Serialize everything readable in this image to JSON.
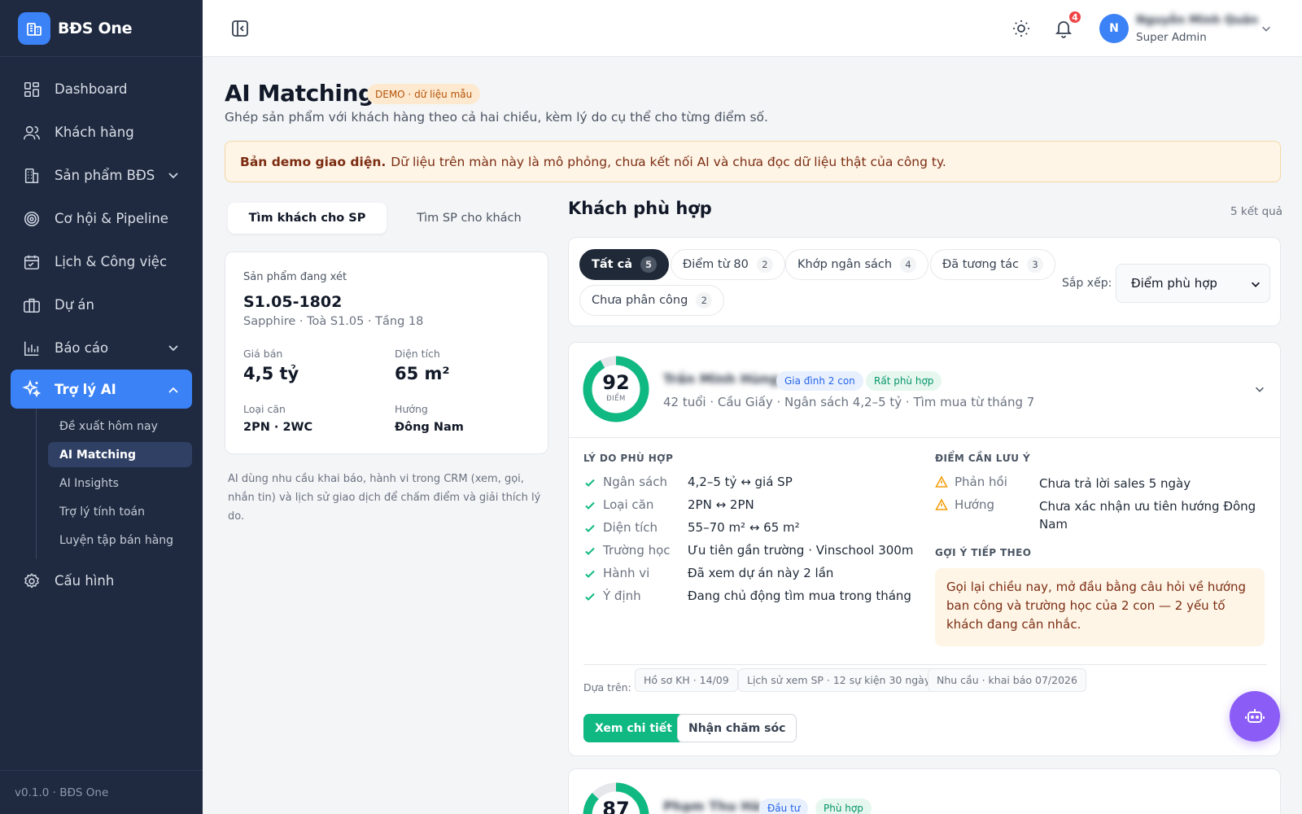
{
  "app": {
    "name": "BĐS One",
    "version": "v0.1.0 · BĐS One"
  },
  "sidebar": {
    "items": [
      {
        "label": "Dashboard",
        "icon": "dashboard-icon"
      },
      {
        "label": "Khách hàng",
        "icon": "users-icon"
      },
      {
        "label": "Sản phẩm BĐS",
        "icon": "building-icon"
      },
      {
        "label": "Cơ hội & Pipeline",
        "icon": "target-icon"
      },
      {
        "label": "Lịch & Công việc",
        "icon": "calendar-icon"
      },
      {
        "label": "Dự án",
        "icon": "projects-icon"
      },
      {
        "label": "Báo cáo",
        "icon": "chart-icon"
      },
      {
        "label": "Trợ lý AI",
        "icon": "sparkle-icon"
      },
      {
        "label": "Cấu hình",
        "icon": "gear-icon"
      }
    ],
    "sub_items": [
      "Đề xuất hôm nay",
      "AI Matching",
      "AI Insights",
      "Trợ lý tính toán",
      "Luyện tập bán hàng"
    ],
    "active_color": "#3b82f6",
    "bg_color": "#1f2a40"
  },
  "topbar": {
    "notifications": "4",
    "avatar_initial": "N",
    "user_name": "Nguyễn Minh Quân",
    "user_role": "Super Admin"
  },
  "page": {
    "title": "AI Matching",
    "badge": "DEMO · dữ liệu mẫu",
    "subtitle": "Ghép sản phẩm với khách hàng theo cả hai chiều, kèm lý do cụ thể cho từng điểm số.",
    "alert_bold": "Bản demo giao diện.",
    "alert_text": "Dữ liệu trên màn này là mô phỏng, chưa kết nối AI và chưa đọc dữ liệu thật của công ty."
  },
  "tabs": [
    "Tìm khách cho SP",
    "Tìm SP cho khách"
  ],
  "product": {
    "label": "Sản phẩm đang xét",
    "code": "S1.05-1802",
    "location": "Sapphire · Toà S1.05 · Tầng 18",
    "price_label": "Giá bán",
    "price": "4,5 tỷ",
    "area_label": "Diện tích",
    "area": "65 m²",
    "type_label": "Loại căn",
    "type": "2PN · 2WC",
    "direction_label": "Hướng",
    "direction": "Đông Nam"
  },
  "note": "AI dùng nhu cầu khai báo, hành vi trong CRM (xem, gọi, nhắn tin) và lịch sử giao dịch để chấm điểm và giải thích lý do.",
  "results": {
    "title": "Khách phù hợp",
    "count": "5 kết quả",
    "filters": [
      {
        "label": "Tất cả",
        "count": "5"
      },
      {
        "label": "Điểm từ 80",
        "count": "2"
      },
      {
        "label": "Khớp ngân sách",
        "count": "4"
      },
      {
        "label": "Đã tương tác",
        "count": "3"
      },
      {
        "label": "Chưa phân công",
        "count": "2"
      }
    ],
    "sort_label": "Sắp xếp:",
    "sort_value": "Điểm phù hợp"
  },
  "match1": {
    "score": 92,
    "score_label": "ĐIỂM",
    "name": "Trần Minh Hùng",
    "tag1": "Gia đình 2 con",
    "tag2": "Rất phù hợp",
    "info": "42 tuổi · Cầu Giấy · Ngân sách 4,2–5 tỷ · Tìm mua từ tháng 7",
    "reasons_title": "LÝ DO PHÙ HỢP",
    "reasons": [
      {
        "k": "Ngân sách",
        "v": "4,2–5 tỷ ↔ giá SP"
      },
      {
        "k": "Loại căn",
        "v": "2PN ↔ 2PN"
      },
      {
        "k": "Diện tích",
        "v": "55–70 m² ↔ 65 m²"
      },
      {
        "k": "Trường học",
        "v": "Ưu tiên gần trường · Vinschool 300m"
      },
      {
        "k": "Hành vi",
        "v": "Đã xem dự án này 2 lần"
      },
      {
        "k": "Ý định",
        "v": "Đang chủ động tìm mua trong tháng"
      }
    ],
    "warnings_title": "ĐIỂM CẦN LƯU Ý",
    "warnings": [
      {
        "k": "Phản hồi",
        "v": "Chưa trả lời sales 5 ngày"
      },
      {
        "k": "Hướng",
        "v": "Chưa xác nhận ưu tiên hướng Đông Nam"
      }
    ],
    "suggest_title": "GỢI Ý TIẾP THEO",
    "suggest": "Gọi lại chiều nay, mở đầu bằng câu hỏi về hướng ban công và trường học của 2 con — 2 yếu tố khách đang cân nhắc.",
    "based_label": "Dựa trên:",
    "sources": [
      "Hồ sơ KH · 14/09",
      "Lịch sử xem SP · 12 sự kiện 30 ngày",
      "Nhu cầu · khai báo 07/2026"
    ],
    "btn_detail": "Xem chi tiết",
    "btn_care": "Nhận chăm sóc"
  },
  "match2": {
    "score": 87,
    "name": "Phạm Thu Hà",
    "tag1": "Đầu tư",
    "tag2": "Phù hợp"
  }
}
